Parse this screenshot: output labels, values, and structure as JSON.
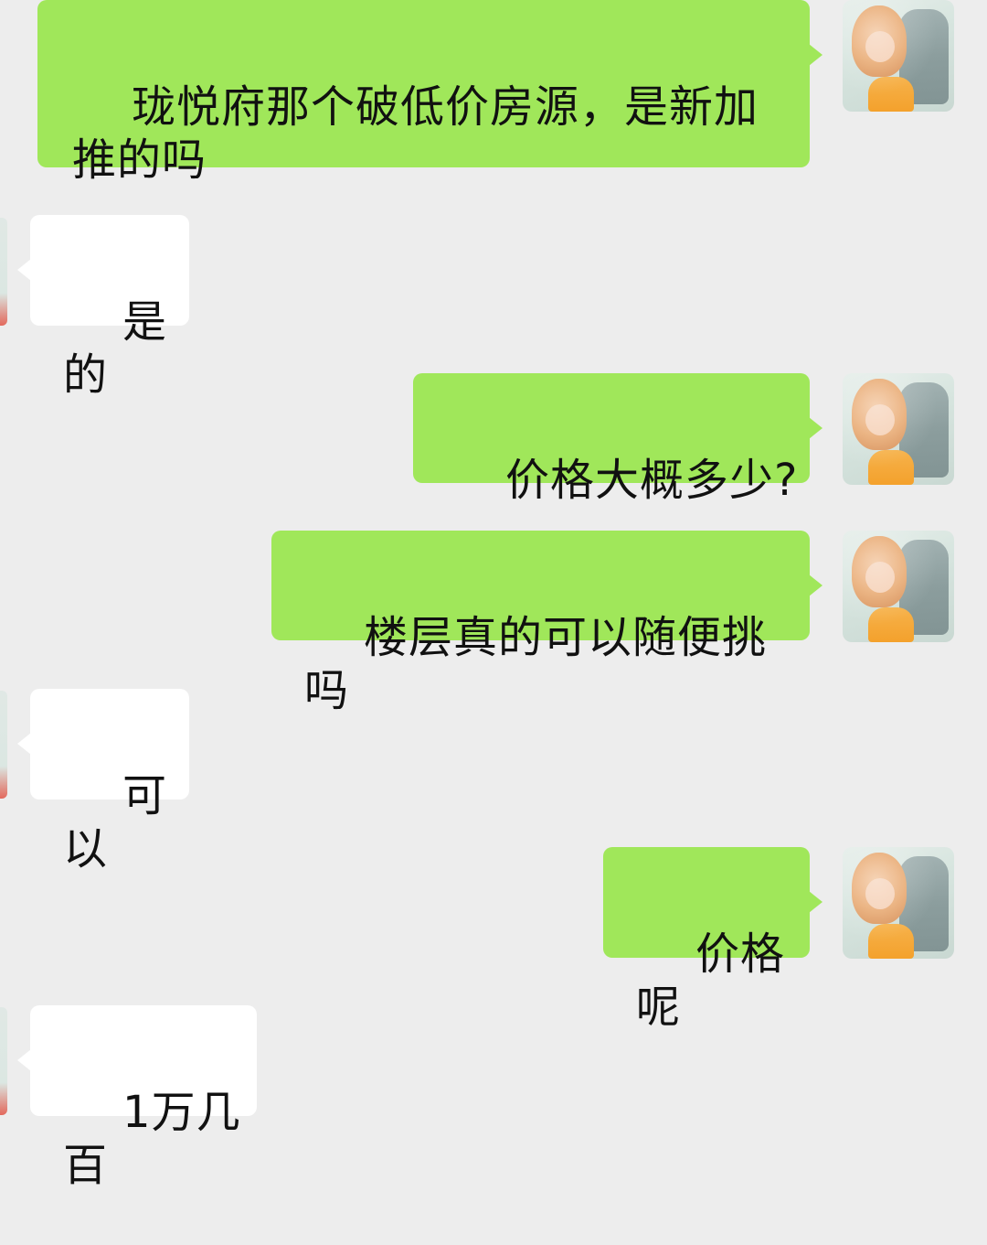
{
  "chat": {
    "messages": [
      {
        "sender": "me",
        "text": "珑悦府那个破低价房源，是新加推的吗",
        "avatar": "user-avatar"
      },
      {
        "sender": "agent",
        "text": "是的"
      },
      {
        "sender": "me",
        "text": "价格大概多少?",
        "avatar": "user-avatar"
      },
      {
        "sender": "me",
        "text": "楼层真的可以随便挑吗",
        "avatar": "user-avatar"
      },
      {
        "sender": "agent",
        "text": "可以"
      },
      {
        "sender": "me",
        "text": "价格呢",
        "avatar": "user-avatar"
      },
      {
        "sender": "agent",
        "text": "1万几百"
      }
    ]
  },
  "colors": {
    "background": "#ededed",
    "outgoing_bubble": "#a0e75a",
    "incoming_bubble": "#ffffff",
    "text": "#111111"
  }
}
